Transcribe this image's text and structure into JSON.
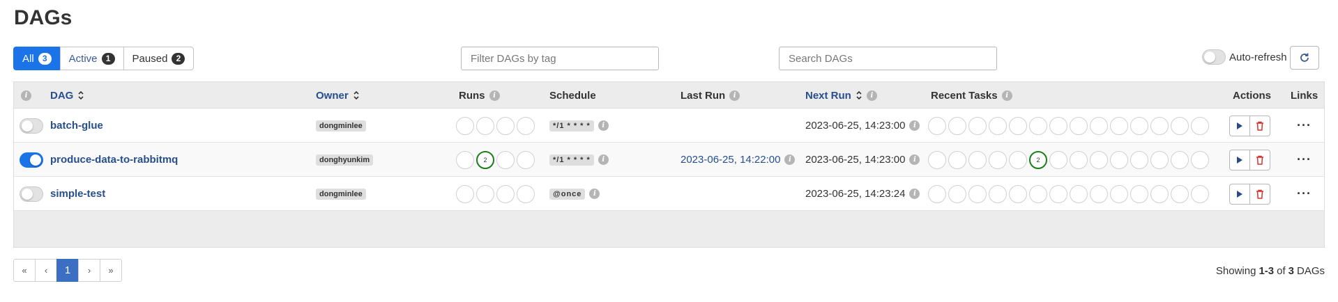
{
  "page": {
    "title": "DAGs"
  },
  "filters": {
    "all": {
      "label": "All",
      "count": "3"
    },
    "active": {
      "label": "Active",
      "count": "1"
    },
    "paused": {
      "label": "Paused",
      "count": "2"
    }
  },
  "tag_filter": {
    "placeholder": "Filter DAGs by tag",
    "value": ""
  },
  "search": {
    "placeholder": "Search DAGs",
    "value": ""
  },
  "auto_refresh": {
    "label": "Auto-refresh",
    "enabled": false
  },
  "table": {
    "headers": {
      "dag": "DAG",
      "owner": "Owner",
      "runs": "Runs",
      "schedule": "Schedule",
      "last_run": "Last Run",
      "next_run": "Next Run",
      "recent_tasks": "Recent Tasks",
      "actions": "Actions",
      "links": "Links"
    },
    "rows": [
      {
        "dag_id": "batch-glue",
        "paused": true,
        "owner": "dongminlee",
        "runs": [
          "",
          "",
          "",
          ""
        ],
        "schedule": "*/1 * * * *",
        "last_run": "",
        "next_run": "2023-06-25, 14:23:00",
        "recent_tasks": [
          "",
          "",
          "",
          "",
          "",
          "",
          "",
          "",
          "",
          "",
          "",
          "",
          "",
          ""
        ]
      },
      {
        "dag_id": "produce-data-to-rabbitmq",
        "paused": false,
        "owner": "donghyunkim",
        "runs": [
          "",
          "2",
          "",
          ""
        ],
        "schedule": "*/1 * * * *",
        "last_run": "2023-06-25, 14:22:00",
        "next_run": "2023-06-25, 14:23:00",
        "recent_tasks": [
          "",
          "",
          "",
          "",
          "",
          "2",
          "",
          "",
          "",
          "",
          "",
          "",
          "",
          ""
        ]
      },
      {
        "dag_id": "simple-test",
        "paused": true,
        "owner": "dongminlee",
        "runs": [
          "",
          "",
          "",
          ""
        ],
        "schedule": "@once",
        "last_run": "",
        "next_run": "2023-06-25, 14:23:24",
        "recent_tasks": [
          "",
          "",
          "",
          "",
          "",
          "",
          "",
          "",
          "",
          "",
          "",
          "",
          "",
          ""
        ]
      }
    ],
    "actions": {
      "more": "···"
    }
  },
  "pagination": {
    "first": "«",
    "prev": "‹",
    "current": "1",
    "next": "›",
    "last": "»"
  },
  "showing": {
    "prefix": "Showing",
    "range": "1-3",
    "of": "of",
    "total": "3",
    "suffix": "DAGs"
  },
  "colors": {
    "accent": "#1b73e8",
    "link": "#274e8d",
    "success": "#1a7f1a",
    "danger": "#d9302c"
  },
  "icons": {
    "info": "info-icon",
    "sort": "sort-icon",
    "play": "play-icon",
    "trash": "trash-icon",
    "refresh": "refresh-icon",
    "more": "more-icon"
  }
}
